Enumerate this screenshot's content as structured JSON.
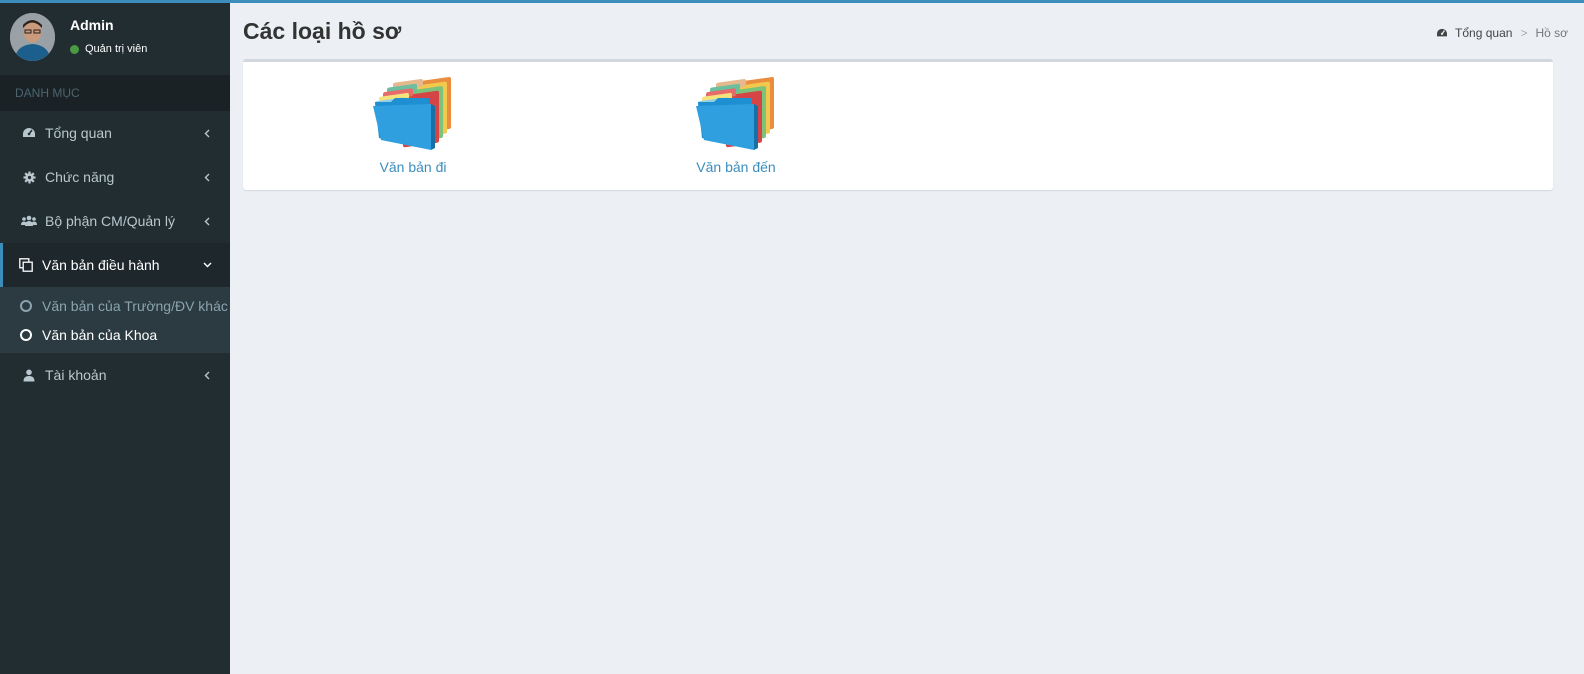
{
  "user": {
    "name": "Admin",
    "role": "Quản trị viên",
    "status_color": "#4a9a43"
  },
  "sidebar": {
    "header": "DANH MỤC",
    "items": [
      {
        "label": "Tổng quan",
        "icon": "dashboard-icon"
      },
      {
        "label": "Chức năng",
        "icon": "gear-icon"
      },
      {
        "label": "Bộ phận CM/Quản lý",
        "icon": "users-icon"
      },
      {
        "label": "Văn bản điều hành",
        "icon": "copy-icon",
        "expanded": true,
        "children": [
          {
            "label": "Văn bản của Trường/ĐV khác"
          },
          {
            "label": "Văn bản của Khoa",
            "current": true
          }
        ]
      },
      {
        "label": "Tài khoản",
        "icon": "user-icon"
      }
    ]
  },
  "page": {
    "title": "Các loại hồ sơ"
  },
  "breadcrumb": {
    "home": "Tổng quan",
    "separator": ">",
    "current": "Hồ sơ"
  },
  "folders": [
    {
      "label": "Văn bản đi",
      "icon": "folder-icon"
    },
    {
      "label": "Văn bản đến",
      "icon": "folder-icon"
    }
  ],
  "colors": {
    "accent": "#3c8dbc",
    "sidebar_bg": "#222d32",
    "content_bg": "#ecf0f5"
  }
}
